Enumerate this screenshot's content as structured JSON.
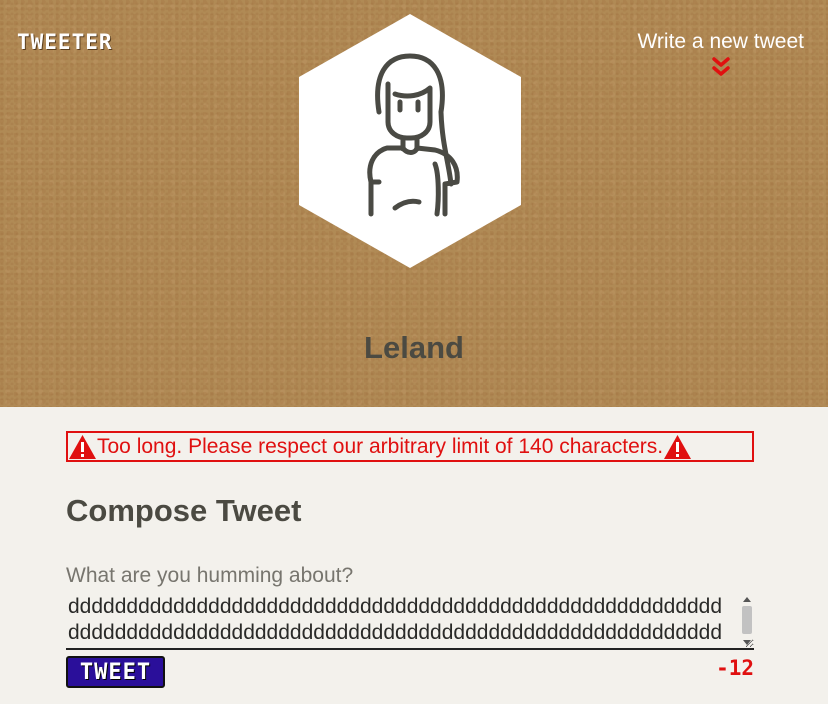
{
  "header": {
    "brand": "TWEETER",
    "new_tweet_link": "Write a new tweet",
    "chevron_icon": "double-chevron-down-icon",
    "avatar_icon": "person-avatar-icon",
    "username": "Leland",
    "colors": {
      "accent": "#e01010",
      "brand_text": "#ffffff",
      "chevron": "#e01010"
    }
  },
  "error": {
    "message": "Too long. Please respect our arbitrary limit of 140 characters.",
    "icon": "warning-triangle-icon",
    "color": "#e01010"
  },
  "compose": {
    "title": "Compose Tweet",
    "placeholder": "What are you humming about?",
    "value": "ddddddddddddddddddddddddddddddddddddddddddddddddddddddddddddddddddddddddddddddddddddddddddddddddddddddddddddddddddasssss",
    "button_label": "TWEET",
    "button_color": "#2a0f9a",
    "counter": "-12",
    "counter_color": "#e01010"
  }
}
